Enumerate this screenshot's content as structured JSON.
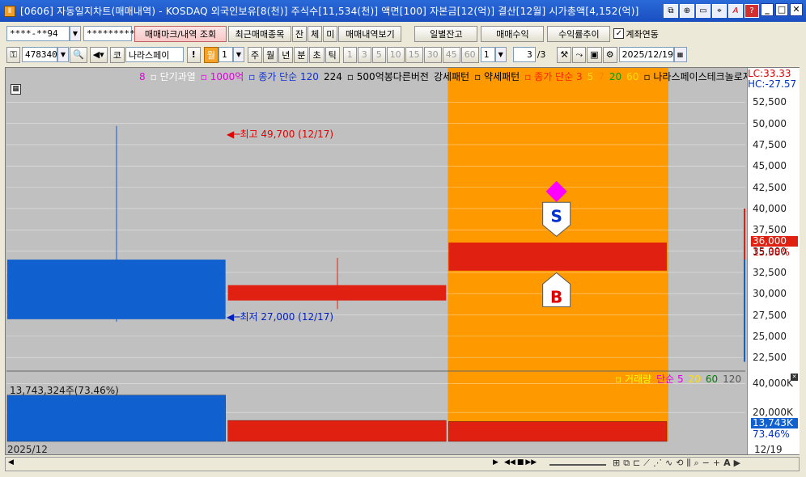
{
  "window": {
    "title": "[0606] 자동일지차트(매매내역) - KOSDAQ 외국인보유[8(천)] 주식수[11,534(천)] 액면[100] 자본금[12(억)] 결산[12월] 시가총액[4,152(억)]",
    "app_icon": "Ⅱ"
  },
  "toolbar1": {
    "account": "****-**94",
    "password": "*********",
    "btn_trade_mark": "매매마크/내역 조회",
    "btn_recent": "최근매매종목",
    "btn_jan": "잔",
    "btn_che": "체",
    "btn_mi": "미",
    "btn_view": "매매내역보기",
    "btn_daily": "일별잔고",
    "btn_profit": "매매수익",
    "btn_return": "수익률추이",
    "chk_account_link": "계좌연동",
    "chk_mark": "✓"
  },
  "toolbar2": {
    "code": "478340",
    "market": "코",
    "stock_name": "나라스페이",
    "period_month": "월",
    "period_n": "1",
    "periods": [
      "주",
      "월",
      "년",
      "분",
      "초",
      "틱"
    ],
    "intervals": [
      "1",
      "3",
      "5",
      "10",
      "15",
      "30",
      "45",
      "60"
    ],
    "interval_sel": "1",
    "page": "3",
    "page_total": "/3",
    "date": "2025/12/19",
    "bang": "!"
  },
  "legend": {
    "price_items": [
      {
        "text": "8",
        "color": "#e000e0"
      },
      {
        "text": "▫ 단기과열",
        "color": "#ffffff"
      },
      {
        "text": "▫ 1000억",
        "color": "#e000e0"
      },
      {
        "text": "▫ 종가 단순 120",
        "color": "#1030d0"
      },
      {
        "text": "224",
        "color": "#000000"
      },
      {
        "text": "▫ 500억봉다른버전",
        "color": "#000000"
      },
      {
        "text": "강세패턴",
        "color": "#000000"
      },
      {
        "text": "▫ 약세패턴",
        "color": "#000000"
      },
      {
        "text": "▫ 종가 단순 3",
        "color": "#ff2000"
      },
      {
        "text": "5",
        "color": "#ffe000"
      },
      {
        "text": "7",
        "color": "#ff8000"
      },
      {
        "text": "20",
        "color": "#00a000"
      },
      {
        "text": "60",
        "color": "#ffe000"
      },
      {
        "text": "▫ 나라스페이스테크놀로지",
        "color": "#000000"
      }
    ],
    "volume_items": [
      {
        "text": "▫ 거래량",
        "color": "#ffff00"
      },
      {
        "text": "단순 5",
        "color": "#e000e0"
      },
      {
        "text": "20",
        "color": "#ffe000"
      },
      {
        "text": "60",
        "color": "#008000"
      },
      {
        "text": "120",
        "color": "#555555"
      }
    ]
  },
  "axis": {
    "lc": "LC:33.33",
    "hc": "HC:-27.57",
    "price_ticks": [
      "52,500",
      "50,000",
      "47,500",
      "45,000",
      "42,500",
      "40,000",
      "37,500",
      "35,000",
      "32,500",
      "30,000",
      "27,500",
      "25,000",
      "22,500"
    ],
    "current_price": "36,000",
    "current_pct": "15.38%",
    "volume_ticks": [
      "40,000K",
      "20,000K"
    ],
    "current_volume": "13,743K",
    "current_volume_pct": "73.46%",
    "date_left": "2025/12",
    "date_right": "12/19"
  },
  "annotations": {
    "high": "최고 49,700 (12/17)",
    "low": "최저 27,000 (12/17)",
    "volume_label": "13,743,324주(73.46%)",
    "sell_mark": "S",
    "buy_mark": "B"
  },
  "chart_data": {
    "type": "candlestick",
    "price_ylim": [
      21000,
      55000
    ],
    "volume_ylim": [
      0,
      48000
    ],
    "candles": [
      {
        "open": 34000,
        "close": 27000,
        "high": 49700,
        "low": 26700,
        "color": "#1060d0"
      },
      {
        "open": 29200,
        "close": 31000,
        "high": 34200,
        "low": 28200,
        "color": "#e02010"
      },
      {
        "open": 32700,
        "close": 36000,
        "high": 36000,
        "low": 32700,
        "color": "#e02010"
      }
    ],
    "volumes": [
      32000,
      14500,
      13743
    ],
    "highlight_candle": 2,
    "sell_price": 37500,
    "buy_price": 31700,
    "diamond_price": 42000,
    "colors": {
      "up": "#e02010",
      "down": "#1060d0",
      "highlight": "#ff9900",
      "background": "#c0c0c0",
      "diamond": "#ff00ff"
    }
  }
}
